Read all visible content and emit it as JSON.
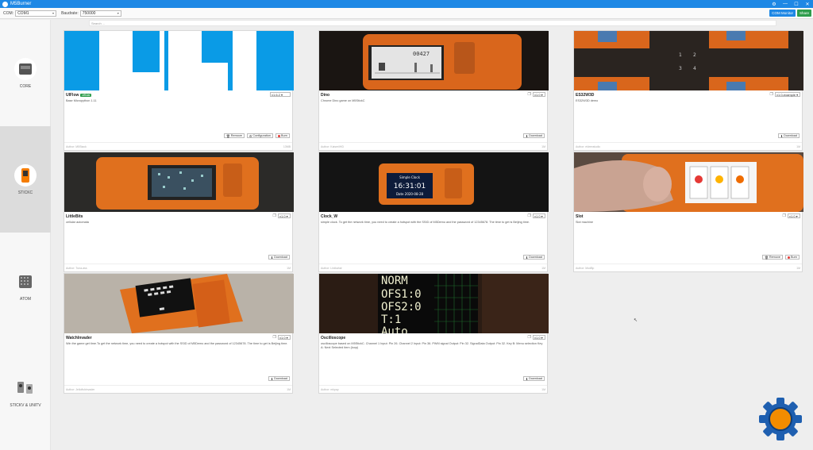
{
  "app": {
    "title": "M5Burner",
    "brand_color": "#1e88e5"
  },
  "toolbar": {
    "com_label": "COM:",
    "com_value": "COM1",
    "baud_label": "Baudrate:",
    "baud_value": "750000",
    "com_monitor": "COM Monitor",
    "share": "Share"
  },
  "search": {
    "placeholder": "Search ..."
  },
  "sidebar": [
    {
      "label": "CORE"
    },
    {
      "label": "STICKC"
    },
    {
      "label": "ATOM"
    },
    {
      "label": "STICKV & UNITV"
    }
  ],
  "cards": [
    {
      "name": "UIFlow",
      "badge": "official",
      "version": "v1.6.2",
      "desc": "Base Micropython 1.11",
      "author": "Author: M5Stack",
      "size": "13MB",
      "buttons": [
        "Remove",
        "Configuration",
        "Burn"
      ]
    },
    {
      "name": "Dino",
      "version": "v1.0",
      "desc": "Chrome Dino game on M5StickC",
      "author": "Author: Kaiser/iHD",
      "size": "1M",
      "buttons": [
        "Download"
      ],
      "screen_text": "00427"
    },
    {
      "name": "ES32W3D",
      "version": "v1.0-example",
      "desc": "ES32W3D demo",
      "author": "Author: eldrexstudio",
      "size": "1M",
      "buttons": [
        "Download"
      ]
    },
    {
      "name": "LittleBits",
      "version": "v1.0",
      "desc": "cellular automata",
      "author": "Author: Tuna-ass",
      "size": "1M",
      "buttons": [
        "Download"
      ]
    },
    {
      "name": "Clock_W",
      "version": "v1.0",
      "desc": "simple clock. To get the network time, you need to create a hotspot with the SSID of M5Demo and the password of 12345678. The time to get is Beijing time.",
      "author": "Author: Lirdkahal",
      "size": "1M",
      "buttons": [
        "Download"
      ],
      "screen_text": [
        "Simple Clock",
        "16:31:01",
        "Date 2020-08-28"
      ]
    },
    {
      "name": "Slot",
      "version": "v1.0",
      "desc": "Slot machine",
      "author": "Author: ModBp",
      "size": "1M",
      "buttons": [
        "Remove",
        "Burn"
      ]
    },
    {
      "name": "WatchInvader",
      "version": "v1.0",
      "desc": "Win the game get time.To get the network time, you need to create a hotspot with the SSID of M5Demo and the password of 12345678. The time to get is Beijing time.",
      "author": "Author: Jellofishinvader",
      "size": "1M",
      "buttons": [
        "Download"
      ]
    },
    {
      "name": "Oscilloscope",
      "version": "v1.0",
      "desc": "oscilloscope based on M5StickC. Channel 1 Input: Pin 26. Channel 2 Input: Pin 36. PWM signal Output: Pin 32. SignalData Output: Pin 32. Key B: Menu selection Key A: Next Selected item (loop)",
      "author": "Author: mkpay",
      "size": "1M",
      "buttons": [
        "Download"
      ],
      "screen_text": [
        "NORM",
        "OFS1:0",
        "OFS2:0",
        "T:1",
        "Auto"
      ]
    }
  ]
}
